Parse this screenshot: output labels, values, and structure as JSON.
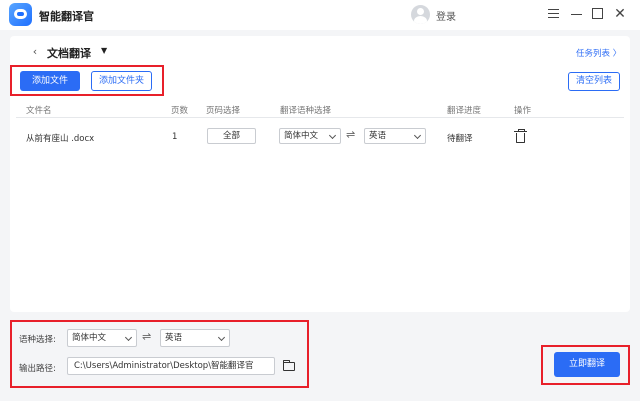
{
  "app": {
    "title": "智能翻译官",
    "login": "登录"
  },
  "header": {
    "page_title": "文档翻译",
    "task_list": "任务列表 〉"
  },
  "toolbar": {
    "add_file": "添加文件",
    "add_folder": "添加文件夹",
    "clear_list": "清空列表"
  },
  "table": {
    "headers": [
      "文件名",
      "页数",
      "页码选择",
      "翻译语种选择",
      "翻译进度",
      "操作"
    ],
    "rows": [
      {
        "file_name": "从前有座山 .docx",
        "pages": "1",
        "page_select": "全部",
        "source_lang": "简体中文",
        "target_lang": "英语",
        "progress": "待翻译"
      }
    ]
  },
  "bottom": {
    "lang_label": "语种选择:",
    "source_lang": "简体中文",
    "target_lang": "英语",
    "output_label": "输出路径:",
    "output_path": "C:\\Users\\Administrator\\Desktop\\智能翻译官",
    "translate_button": "立即翻译"
  },
  "colors": {
    "accent": "#2b6cf5",
    "annotation": "#e8202a"
  }
}
